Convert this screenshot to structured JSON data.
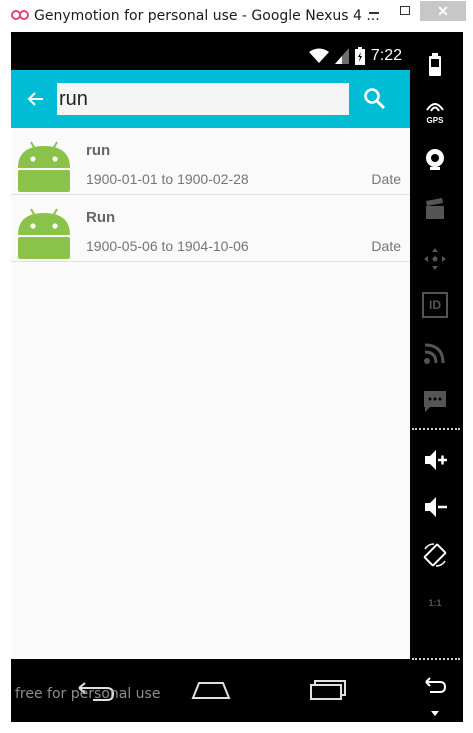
{
  "window": {
    "title": "Genymotion for personal use - Google Nexus 4 ...",
    "close_label": "✕"
  },
  "statusbar": {
    "time": "7:22",
    "icons": [
      "wifi-icon",
      "signal-icon",
      "battery-icon"
    ]
  },
  "search": {
    "query": "run",
    "back_icon": "arrow-left-icon",
    "search_icon": "search-icon"
  },
  "results": [
    {
      "title": "run",
      "range": "1900-01-01 to 1900-02-28",
      "type": "Date",
      "icon": "android-icon"
    },
    {
      "title": "Run",
      "range": "1900-05-06 to 1904-10-06",
      "type": "Date",
      "icon": "android-icon"
    }
  ],
  "navbar": {
    "buttons": [
      "back-icon",
      "home-icon",
      "recents-icon"
    ],
    "watermark": "free for personal use"
  },
  "side_panel": {
    "gps_label": "GPS",
    "id_label": "ID",
    "pixel_label": "1:1",
    "icons": [
      "battery-icon",
      "gps-icon",
      "webcam-icon",
      "video-icon",
      "dpad-icon",
      "id-icon",
      "rss-icon",
      "sms-icon",
      "volume-up-icon",
      "volume-down-icon",
      "rotate-icon",
      "pixel-perfect-icon",
      "back-icon",
      "more-icon"
    ]
  },
  "colors": {
    "toolbar": "#00bcd4",
    "android_green": "#8bc34a",
    "list_background": "#fafafa"
  }
}
